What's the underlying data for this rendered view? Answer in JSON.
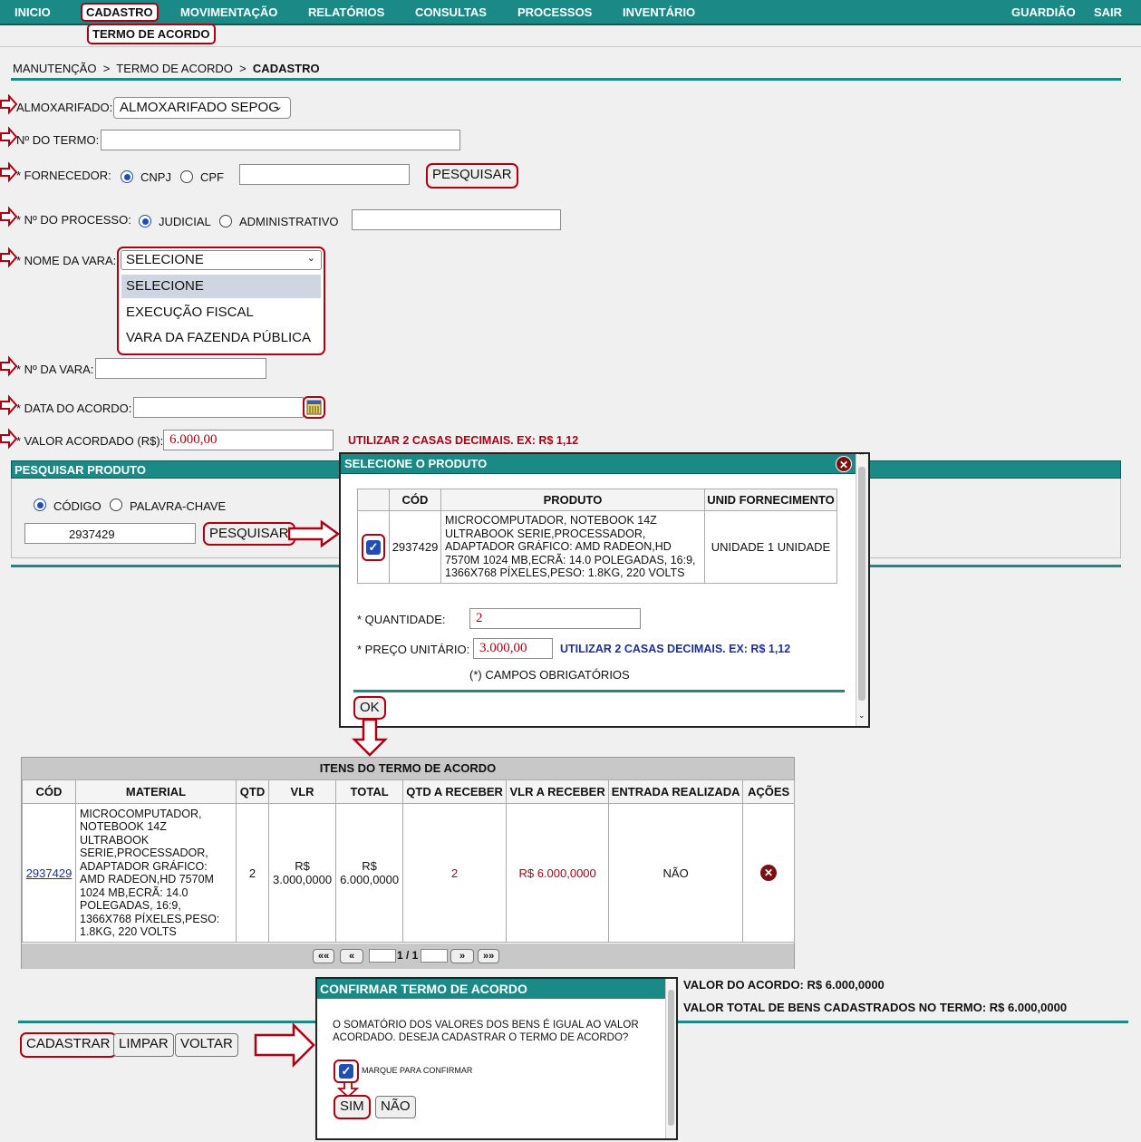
{
  "nav": {
    "inicio": "INICIO",
    "cadastro": "CADASTRO",
    "movimentacao": "MOVIMENTAÇÃO",
    "relatorios": "RELATÓRIOS",
    "consultas": "CONSULTAS",
    "processos": "PROCESSOS",
    "inventario": "INVENTÁRIO",
    "guardiao": "GUARDIÃO",
    "sair": "SAIR",
    "submenu": "TERMO DE ACORDO"
  },
  "breadcrumb": {
    "p1": "MANUTENÇÃO",
    "sep1": ">",
    "p2": "TERMO DE ACORDO",
    "sep2": ">",
    "p3": "CADASTRO"
  },
  "form": {
    "almoxarifado_label": "ALMOXARIFADO:",
    "almoxarifado_value": "ALMOXARIFADO SEPOG",
    "termo_label": "Nº DO TERMO:",
    "fornecedor_label": "* FORNECEDOR:",
    "cnpj": "CNPJ",
    "cpf": "CPF",
    "pesquisar": "PESQUISAR",
    "processo_label": "* Nº DO PROCESSO:",
    "judicial": "JUDICIAL",
    "administrativo": "ADMINISTRATIVO",
    "vara_label": "* NOME DA VARA:",
    "vara_selected": "SELECIONE",
    "vara_options": [
      "SELECIONE",
      "EXECUÇÃO FISCAL",
      "VARA DA FAZENDA PÚBLICA"
    ],
    "num_vara_label": "* Nº DA VARA:",
    "data_label": "* DATA DO ACORDO:",
    "valor_label": "* VALOR ACORDADO (R$):",
    "valor_value": "6.000,00",
    "valor_hint": "UTILIZAR 2 CASAS DECIMAIS. EX: R$ 1,12"
  },
  "pesquisar_produto": {
    "title": "PESQUISAR PRODUTO",
    "codigo": "CÓDIGO",
    "palavra": "PALAVRA-CHAVE",
    "search_value": "2937429",
    "button": "PESQUISAR"
  },
  "modal_produto": {
    "title": "SELECIONE O PRODUTO",
    "headers": [
      "CÓD",
      "PRODUTO",
      "UNID FORNECIMENTO"
    ],
    "row": {
      "cod": "2937429",
      "produto": "MICROCOMPUTADOR, NOTEBOOK 14Z ULTRABOOK SERIE,PROCESSADOR, ADAPTADOR GRÁFICO: AMD RADEON,HD 7570M 1024 MB,ECRÃ: 14.0 POLEGADAS, 16:9, 1366X768 PÍXELES,PESO: 1.8KG, 220 VOLTS",
      "unid": "UNIDADE 1 UNIDADE"
    },
    "quantidade_label": "* QUANTIDADE:",
    "quantidade_value": "2",
    "preco_label": "* PREÇO UNITÁRIO:",
    "preco_value": "3.000,00",
    "preco_hint": "UTILIZAR 2 CASAS DECIMAIS. EX: R$ 1,12",
    "obrigatorios": "(*) CAMPOS OBRIGATÓRIOS",
    "ok": "OK"
  },
  "itens": {
    "title": "ITENS DO TERMO DE ACORDO",
    "headers": [
      "CÓD",
      "MATERIAL",
      "QTD",
      "VLR",
      "TOTAL",
      "QTD A RECEBER",
      "VLR A RECEBER",
      "ENTRADA REALIZADA",
      "AÇÕES"
    ],
    "row": {
      "cod": "2937429",
      "material": "MICROCOMPUTADOR, NOTEBOOK 14Z ULTRABOOK SERIE,PROCESSADOR, ADAPTADOR GRÁFICO: AMD RADEON,HD 7570M 1024 MB,ECRÃ: 14.0 POLEGADAS, 16:9, 1366X768 PÍXELES,PESO: 1.8KG, 220 VOLTS",
      "qtd": "2",
      "vlr": "R$ 3.000,0000",
      "total": "R$ 6.000,0000",
      "qtd_receber": "2",
      "vlr_receber": "R$ 6.000,0000",
      "entrada": "NÃO"
    },
    "pager": {
      "first": "««",
      "prev": "«",
      "page": "1 / 1",
      "next": "»",
      "last": "»»"
    }
  },
  "totais": {
    "valor_acordo": "VALOR DO ACORDO: R$ 6.000,0000",
    "valor_total": "VALOR TOTAL DE BENS CADASTRADOS NO TERMO: R$ 6.000,0000"
  },
  "actions": {
    "cadastrar": "CADASTRAR",
    "limpar": "LIMPAR",
    "voltar": "VOLTAR"
  },
  "confirm": {
    "title": "CONFIRMAR TERMO DE ACORDO",
    "message": "O SOMATÓRIO DOS VALORES DOS BENS É IGUAL AO VALOR ACORDADO. DESEJA CADASTRAR O TERMO DE ACORDO?",
    "checkbox_label": "MARQUE PARA CONFIRMAR",
    "sim": "SIM",
    "nao": "NÃO"
  },
  "colors": {
    "teal": "#1b8a87",
    "highlight_red": "#b00012",
    "hint_blue": "#1d2f9c"
  }
}
